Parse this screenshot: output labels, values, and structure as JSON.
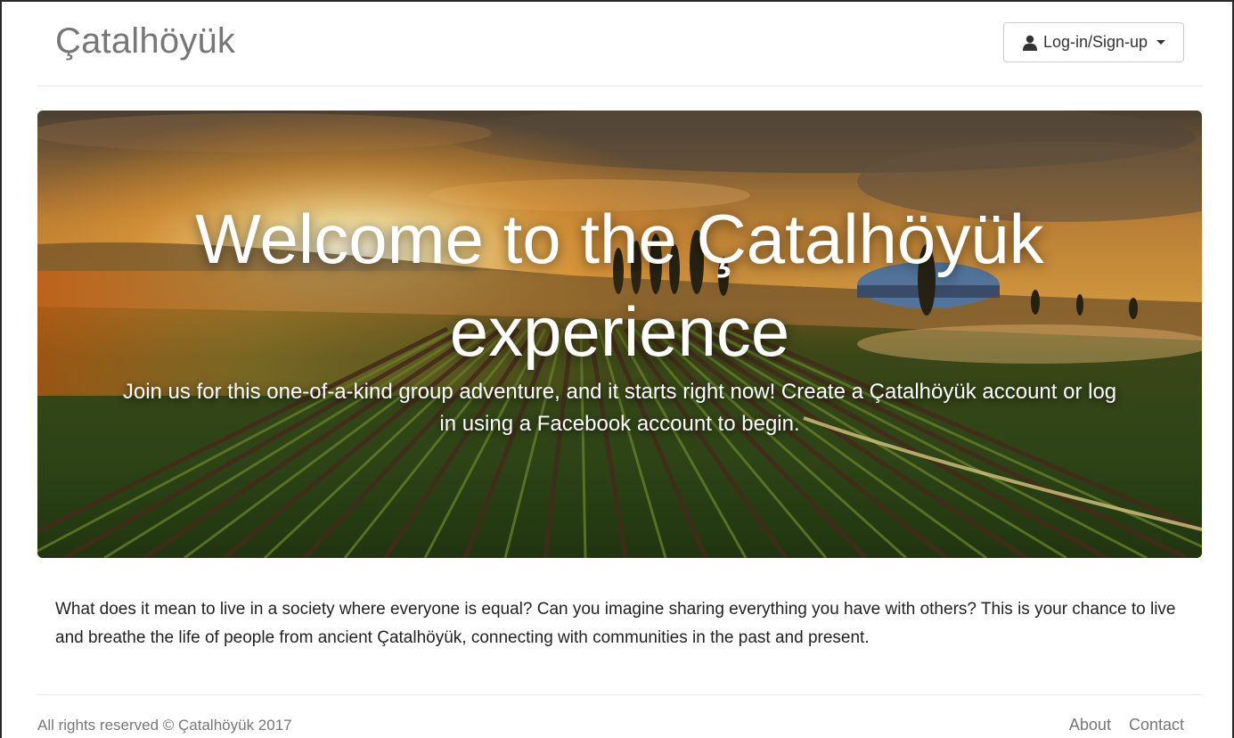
{
  "navbar": {
    "brand": "Çatalhöyük",
    "login_label": "Log-in/Sign-up",
    "login_icon": "user-icon"
  },
  "hero": {
    "title_line1": "Welcome to the Çatalhöyük",
    "title_line2": "experience",
    "subtitle": "Join us for this one-of-a-kind group adventure, and it starts right now! Create a Çatalhöyük account or log in using a Facebook account to begin."
  },
  "intro": {
    "text": "What does it mean to live in a society where everyone is equal? Can you imagine sharing everything you have with others? This is your chance to live and breathe the life of people from ancient Çatalhöyük, connecting with communities in the past and present."
  },
  "footer": {
    "copyright": "All rights reserved © Çatalhöyük 2017",
    "links": [
      "About",
      "Contact"
    ]
  },
  "colors": {
    "brand_text": "#777777",
    "sky_top": "#5a4a38",
    "sun_glow": "#fff3c4",
    "field_green": "#3d5a1e",
    "soil": "#4a2e1e"
  }
}
